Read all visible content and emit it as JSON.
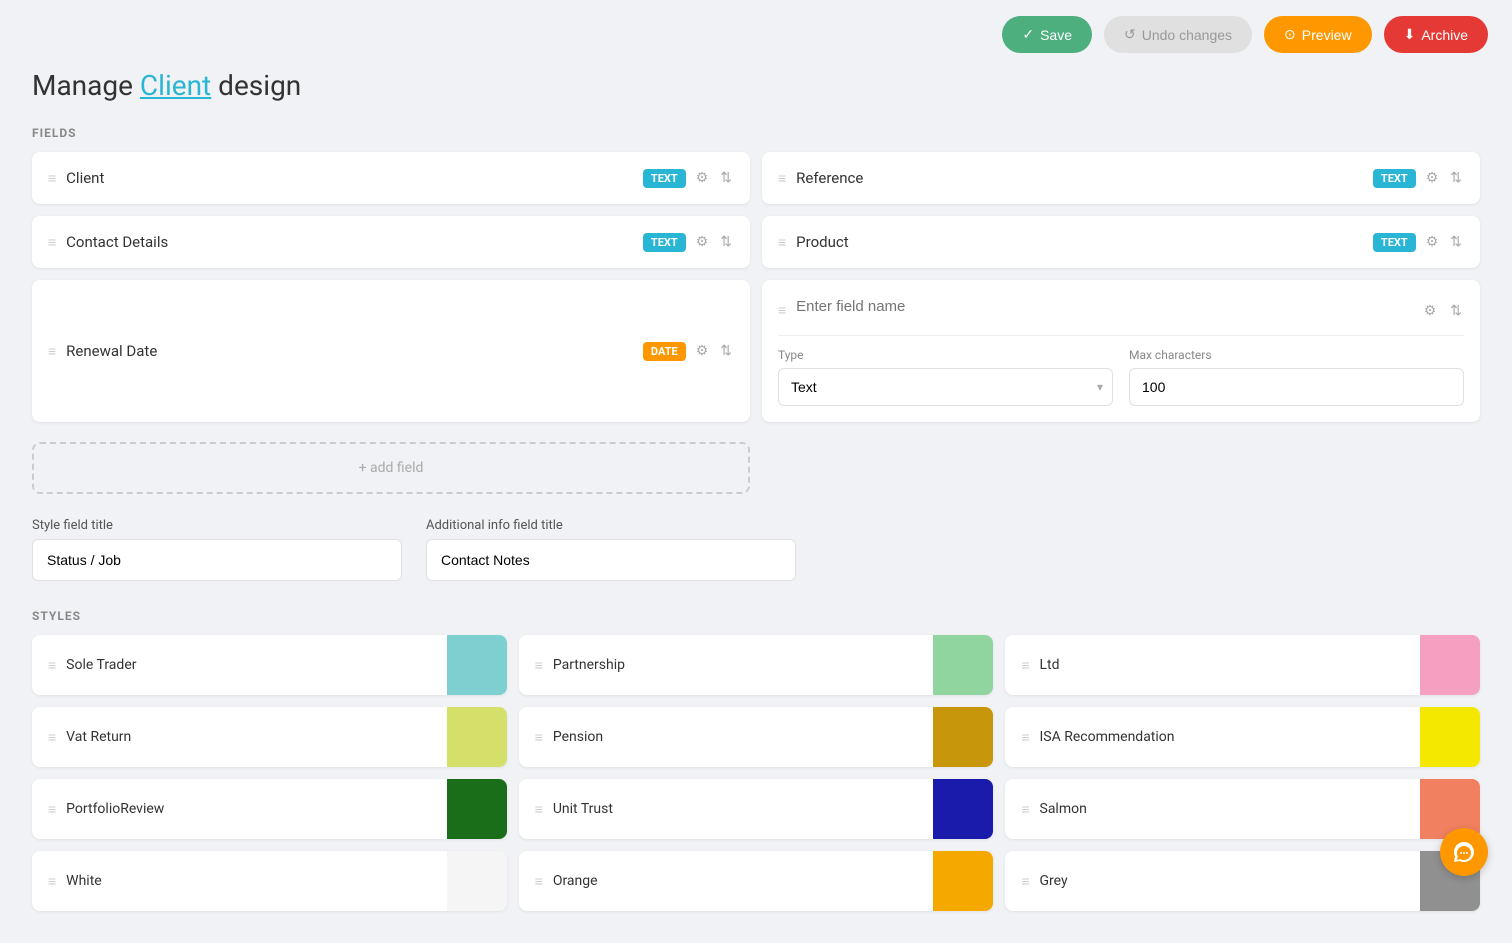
{
  "topbar": {
    "save_label": "Save",
    "undo_label": "Undo changes",
    "preview_label": "Preview",
    "archive_label": "Archive"
  },
  "page": {
    "title_prefix": "Manage",
    "title_highlight": "Client",
    "title_suffix": "design"
  },
  "fields_section": {
    "label": "FIELDS",
    "fields": [
      {
        "name": "Client",
        "badge": "TEXT",
        "badge_type": "text"
      },
      {
        "name": "Reference",
        "badge": "TEXT",
        "badge_type": "text"
      },
      {
        "name": "Contact Details",
        "badge": "TEXT",
        "badge_type": "text"
      },
      {
        "name": "Product",
        "badge": "TEXT",
        "badge_type": "text"
      },
      {
        "name": "Renewal Date",
        "badge": "DATE",
        "badge_type": "date"
      }
    ],
    "new_field_placeholder": "Enter field name",
    "add_field_label": "+ add field",
    "type_label": "Type",
    "type_value": "Text",
    "max_label": "Max characters",
    "max_value": "100"
  },
  "info_fields": {
    "style_title_label": "Style field title",
    "style_title_value": "Status / Job",
    "additional_title_label": "Additional info field title",
    "additional_title_value": "Contact Notes"
  },
  "styles_section": {
    "label": "STYLES",
    "styles": [
      {
        "name": "Sole Trader",
        "color": "#7ecfcf"
      },
      {
        "name": "Partnership",
        "color": "#90d4a0"
      },
      {
        "name": "Ltd",
        "color": "#f5a0c0"
      },
      {
        "name": "Vat Return",
        "color": "#d4e06a"
      },
      {
        "name": "Pension",
        "color": "#c8960a"
      },
      {
        "name": "ISA Recommendation",
        "color": "#f5e800"
      },
      {
        "name": "PortfolioReview",
        "color": "#1a6e1a"
      },
      {
        "name": "Unit Trust",
        "color": "#1a1aab"
      },
      {
        "name": "Salmon",
        "color": "#f08060"
      },
      {
        "name": "White",
        "color": "#f5f5f5"
      },
      {
        "name": "Orange",
        "color": "#f5a800"
      },
      {
        "name": "Grey",
        "color": "#909090"
      }
    ]
  }
}
